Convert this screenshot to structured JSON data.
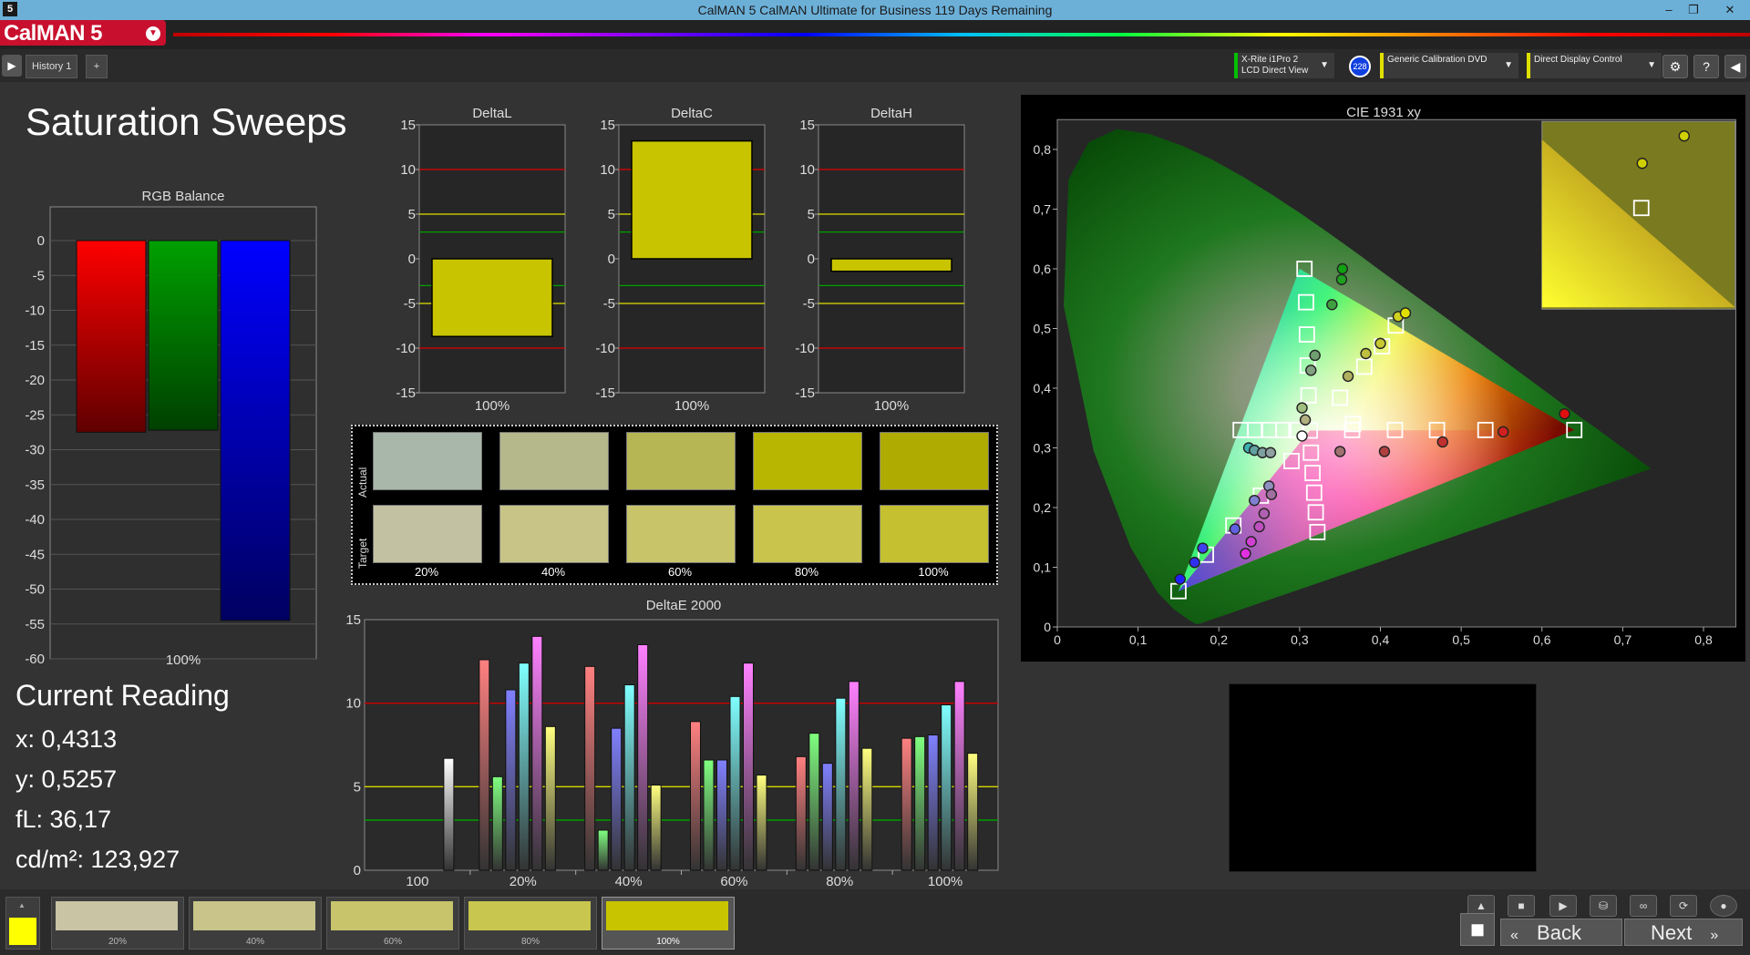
{
  "window": {
    "title": "CalMAN 5 CalMAN Ultimate for Business 119 Days Remaining",
    "app_icon": "5"
  },
  "app": {
    "logo": "CalMAN 5"
  },
  "tabs": {
    "history": "History 1",
    "add": "+"
  },
  "hardware": {
    "meter": {
      "line1": "X-Rite i1Pro 2",
      "line2": "LCD Direct View",
      "badge": "228"
    },
    "source": "Generic Calibration DVD",
    "display": "Direct Display Control"
  },
  "page": {
    "title": "Saturation Sweeps"
  },
  "rgb_balance": {
    "title": "RGB Balance",
    "yticks": [
      "0",
      "-5",
      "-10",
      "-15",
      "-20",
      "-25",
      "-30",
      "-35",
      "-40",
      "-45",
      "-50",
      "-55",
      "-60"
    ],
    "xlabel": "100%",
    "bars": [
      {
        "name": "R",
        "value": -27.5,
        "color": "#ff0000"
      },
      {
        "name": "G",
        "value": -27.2,
        "color": "#00a000"
      },
      {
        "name": "B",
        "value": -54.5,
        "color": "#0000ff"
      }
    ]
  },
  "delta_charts": [
    {
      "title": "DeltaL",
      "value": -8.7,
      "xlabel": "100%"
    },
    {
      "title": "DeltaC",
      "value": 13.2,
      "xlabel": "100%"
    },
    {
      "title": "DeltaH",
      "value": -1.4,
      "xlabel": "100%"
    }
  ],
  "delta_yticks": [
    "15",
    "10",
    "5",
    "0",
    "-5",
    "-10",
    "-15"
  ],
  "swatches": {
    "row_actual": "Actual",
    "row_target": "Target",
    "labels": [
      "20%",
      "40%",
      "60%",
      "80%",
      "100%"
    ],
    "actual": [
      "#a8b7aa",
      "#b5b88a",
      "#b7b654",
      "#b8b600",
      "#b0ab00"
    ],
    "target": [
      "#c2c1a2",
      "#c8c488",
      "#c8c46a",
      "#c8c44c",
      "#c4c030"
    ]
  },
  "deltae": {
    "title": "DeltaE 2000",
    "yticks": [
      "15",
      "10",
      "5",
      "0"
    ],
    "categories": [
      "100",
      "20%",
      "40%",
      "60%",
      "80%",
      "100%"
    ]
  },
  "chart_data": {
    "type": "bar",
    "title": "DeltaE 2000",
    "categories": [
      "100",
      "20%",
      "40%",
      "60%",
      "80%",
      "100%"
    ],
    "ylim": [
      0,
      15
    ],
    "series": [
      {
        "color": "#ffffff",
        "values": [
          6.7,
          null,
          null,
          null,
          null,
          null
        ]
      },
      {
        "color": "#ff8080",
        "values": [
          null,
          12.6,
          12.2,
          8.9,
          6.8,
          7.9
        ]
      },
      {
        "color": "#80ff80",
        "values": [
          null,
          5.6,
          2.4,
          6.6,
          8.2,
          8.0
        ]
      },
      {
        "color": "#8080ff",
        "values": [
          null,
          10.8,
          8.5,
          6.6,
          6.4,
          8.1
        ]
      },
      {
        "color": "#80ffff",
        "values": [
          null,
          12.4,
          11.1,
          10.4,
          10.3,
          9.9
        ]
      },
      {
        "color": "#ff80ff",
        "values": [
          null,
          14.0,
          13.5,
          12.4,
          11.3,
          11.3
        ]
      },
      {
        "color": "#ffff80",
        "values": [
          null,
          8.6,
          5.1,
          5.7,
          7.3,
          7.0
        ]
      }
    ],
    "reference_lines": [
      {
        "value": 10,
        "color": "#d00000"
      },
      {
        "value": 5,
        "color": "#d8d800"
      },
      {
        "value": 3,
        "color": "#00a000"
      }
    ]
  },
  "cie": {
    "title": "CIE 1931 xy",
    "xticks": [
      "0",
      "0,1",
      "0,2",
      "0,3",
      "0,4",
      "0,5",
      "0,6",
      "0,7",
      "0,8"
    ],
    "yticks": [
      "0",
      "0,1",
      "0,2",
      "0,3",
      "0,4",
      "0,5",
      "0,6",
      "0,7",
      "0,8"
    ],
    "target_squares": [
      [
        0.3127,
        0.329
      ],
      [
        0.227,
        0.33
      ],
      [
        0.245,
        0.33
      ],
      [
        0.262,
        0.33
      ],
      [
        0.28,
        0.33
      ],
      [
        0.296,
        0.33
      ],
      [
        0.365,
        0.33
      ],
      [
        0.418,
        0.33
      ],
      [
        0.47,
        0.33
      ],
      [
        0.53,
        0.33
      ],
      [
        0.64,
        0.33
      ],
      [
        0.306,
        0.6
      ],
      [
        0.308,
        0.544
      ],
      [
        0.309,
        0.49
      ],
      [
        0.31,
        0.438
      ],
      [
        0.311,
        0.388
      ],
      [
        0.366,
        0.34
      ],
      [
        0.35,
        0.384
      ],
      [
        0.38,
        0.436
      ],
      [
        0.402,
        0.47
      ],
      [
        0.419,
        0.505
      ],
      [
        0.29,
        0.278
      ],
      [
        0.252,
        0.22
      ],
      [
        0.218,
        0.17
      ],
      [
        0.184,
        0.121
      ],
      [
        0.15,
        0.06
      ],
      [
        0.314,
        0.292
      ],
      [
        0.316,
        0.258
      ],
      [
        0.318,
        0.225
      ],
      [
        0.32,
        0.192
      ],
      [
        0.322,
        0.159
      ]
    ],
    "actual_points": [
      {
        "x": 0.303,
        "y": 0.32,
        "c": "#ffffff"
      },
      {
        "x": 0.237,
        "y": 0.3,
        "c": "#40b0b0"
      },
      {
        "x": 0.244,
        "y": 0.296,
        "c": "#60a0a0"
      },
      {
        "x": 0.254,
        "y": 0.292,
        "c": "#80a0a0"
      },
      {
        "x": 0.264,
        "y": 0.292,
        "c": "#90a0a0"
      },
      {
        "x": 0.307,
        "y": 0.347,
        "c": "#b0b080"
      },
      {
        "x": 0.303,
        "y": 0.367,
        "c": "#a0c080"
      },
      {
        "x": 0.35,
        "y": 0.294,
        "c": "#a07070"
      },
      {
        "x": 0.405,
        "y": 0.294,
        "c": "#b04040"
      },
      {
        "x": 0.477,
        "y": 0.31,
        "c": "#c03030"
      },
      {
        "x": 0.552,
        "y": 0.327,
        "c": "#d02020"
      },
      {
        "x": 0.628,
        "y": 0.357,
        "c": "#e01010"
      },
      {
        "x": 0.319,
        "y": 0.455,
        "c": "#70a070"
      },
      {
        "x": 0.314,
        "y": 0.43,
        "c": "#80a080"
      },
      {
        "x": 0.34,
        "y": 0.54,
        "c": "#40a040"
      },
      {
        "x": 0.352,
        "y": 0.582,
        "c": "#20a020"
      },
      {
        "x": 0.353,
        "y": 0.6,
        "c": "#10a010"
      },
      {
        "x": 0.36,
        "y": 0.42,
        "c": "#b0b060"
      },
      {
        "x": 0.382,
        "y": 0.458,
        "c": "#c0c040"
      },
      {
        "x": 0.4,
        "y": 0.475,
        "c": "#c8c830"
      },
      {
        "x": 0.422,
        "y": 0.52,
        "c": "#d0d020"
      },
      {
        "x": 0.431,
        "y": 0.526,
        "c": "#e0e000"
      },
      {
        "x": 0.262,
        "y": 0.236,
        "c": "#9090c0"
      },
      {
        "x": 0.244,
        "y": 0.212,
        "c": "#8080d0"
      },
      {
        "x": 0.22,
        "y": 0.164,
        "c": "#6060e0"
      },
      {
        "x": 0.18,
        "y": 0.132,
        "c": "#4040f0"
      },
      {
        "x": 0.17,
        "y": 0.108,
        "c": "#3030f0"
      },
      {
        "x": 0.152,
        "y": 0.08,
        "c": "#2020ff"
      },
      {
        "x": 0.265,
        "y": 0.222,
        "c": "#a070a0"
      },
      {
        "x": 0.256,
        "y": 0.19,
        "c": "#b060b0"
      },
      {
        "x": 0.25,
        "y": 0.168,
        "c": "#c050c0"
      },
      {
        "x": 0.24,
        "y": 0.143,
        "c": "#d040d0"
      },
      {
        "x": 0.233,
        "y": 0.123,
        "c": "#e030e0"
      }
    ]
  },
  "current_reading": {
    "title": "Current Reading",
    "x": "x: 0,4313",
    "y": "y: 0,5257",
    "fl": "fL: 36,17",
    "cdm2": "cd/m²: 123,927"
  },
  "bottom": {
    "current_color": "#ffff00",
    "thumbs": [
      {
        "label": "20%",
        "color": "#c8c4a4"
      },
      {
        "label": "40%",
        "color": "#c8c48a"
      },
      {
        "label": "60%",
        "color": "#c8c46c"
      },
      {
        "label": "80%",
        "color": "#c8c64e"
      },
      {
        "label": "100%",
        "color": "#c8c400"
      }
    ],
    "back": "Back",
    "next": "Next"
  }
}
